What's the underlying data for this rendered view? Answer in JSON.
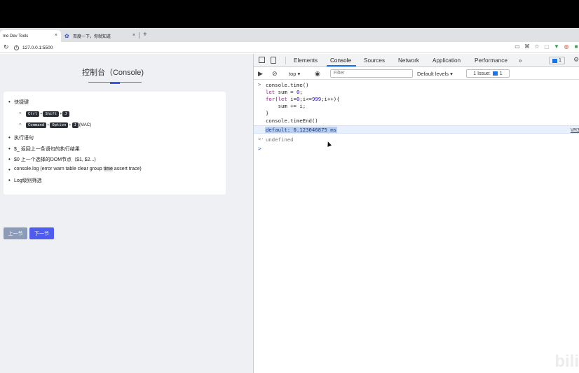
{
  "browser": {
    "tabs": [
      {
        "label": "me Dev Tools",
        "close": "×"
      },
      {
        "label": "百度一下，你就知道",
        "close": "×"
      }
    ],
    "new_tab": "+",
    "url": "127.0.0.1:5500"
  },
  "page": {
    "title": "控制台（Console)",
    "items": [
      "快捷键",
      "执行语句",
      "$_ 返回上一条语句的执行结果",
      "$0 上一个选择的DOM节点（$1, $2...)",
      "console.log (error warn table clear group ",
      "Log级别筛选"
    ],
    "highlight_word": "time",
    "items_tail": " assert trace)",
    "shortcut_win": [
      "Ctrl",
      "Shift",
      "J"
    ],
    "shortcut_mac": [
      "Command",
      "Option",
      "J"
    ],
    "shortcut_mac_suffix": "(MAC)",
    "plus": "+",
    "prev_label": "上一节",
    "next_label": "下一节"
  },
  "devtools": {
    "tabs": [
      "Elements",
      "Console",
      "Sources",
      "Network",
      "Application",
      "Performance"
    ],
    "more": "»",
    "messages_count": "1",
    "context": "top ▾",
    "filter_placeholder": "Filter",
    "levels": "Default levels ▾",
    "issues": "1 Issue:",
    "issues_count": "1"
  },
  "console": {
    "prompt": ">",
    "lines": [
      "console.time()",
      "console.timeEnd()"
    ],
    "output": "default: 0.123046875 ms",
    "source": "VM3",
    "return_arrow": "<·",
    "result": "undefined",
    "cursor": ">"
  },
  "colors": {
    "accent": "#4e5cf0",
    "devtools_blue": "#1a73e8"
  }
}
